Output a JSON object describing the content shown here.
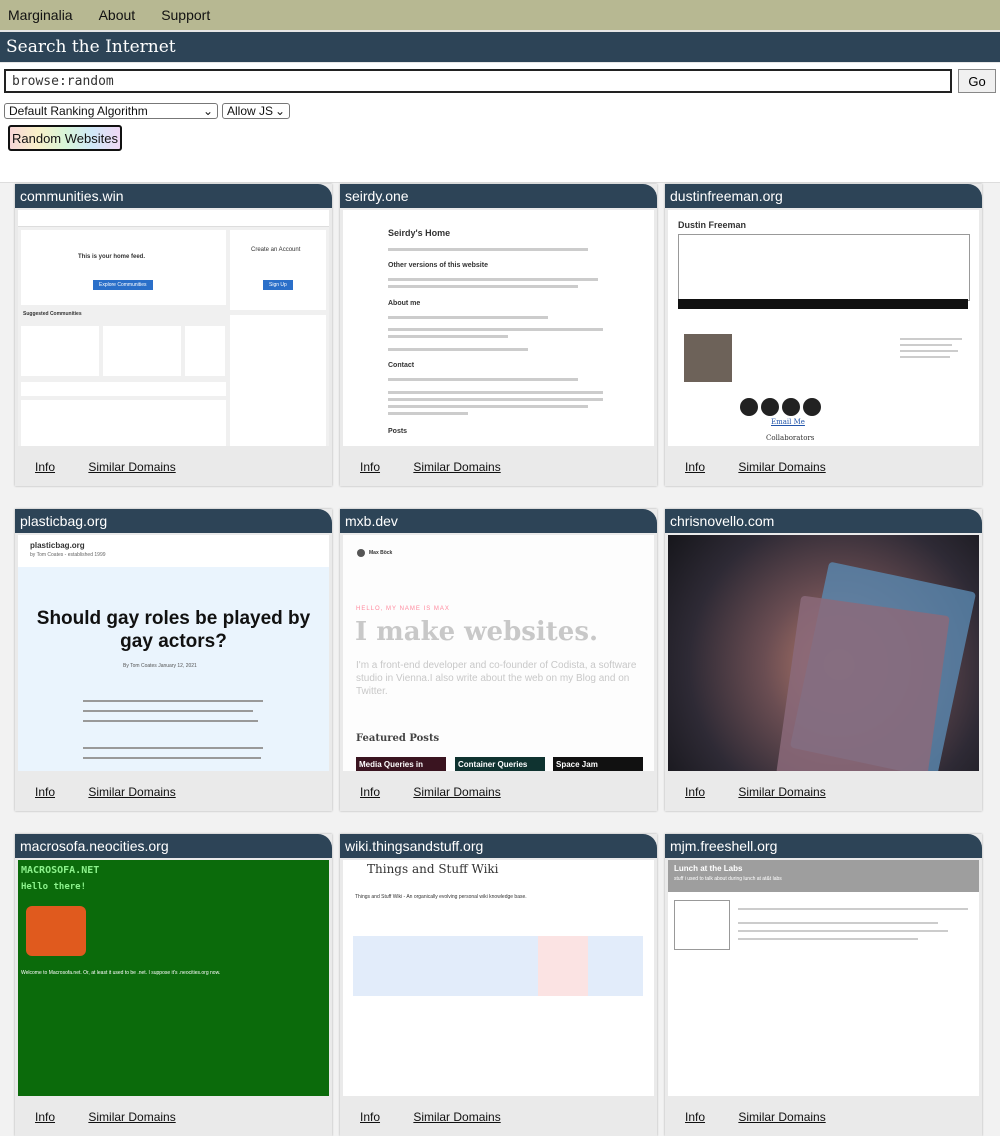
{
  "nav": {
    "items": [
      "Marginalia",
      "About",
      "Support"
    ]
  },
  "search": {
    "title": "Search the Internet",
    "query": "browse:random",
    "go_label": "Go",
    "algorithm": "Default Ranking Algorithm",
    "js": "Allow JS",
    "random_label": "Random Websites"
  },
  "cards": [
    {
      "domain": "communities.win",
      "info": "Info",
      "similar": "Similar Domains",
      "thumb": {
        "title": "This is your home feed.",
        "b1": "Explore Communities",
        "b2": "Create an Account",
        "b3": "Sign Up",
        "sec": "Suggested Communities"
      }
    },
    {
      "domain": "seirdy.one",
      "info": "Info",
      "similar": "Similar Domains",
      "thumb": {
        "h1": "Seirdy's Home",
        "h2a": "Other versions of this website",
        "h2b": "About me",
        "h2c": "Contact",
        "h2d": "Posts"
      }
    },
    {
      "domain": "dustinfreeman.org",
      "info": "Info",
      "similar": "Similar Domains",
      "thumb": {
        "h1": "Dustin Freeman",
        "email": "Email Me",
        "collab": "Collaborators"
      }
    },
    {
      "domain": "plasticbag.org",
      "info": "Info",
      "similar": "Similar Domains",
      "thumb": {
        "site": "plasticbag.org",
        "by": "by Tom Coates - established 1999",
        "h1": "Should gay roles be played by gay actors?",
        "meta": "By Tom Coates    January 12, 2021"
      }
    },
    {
      "domain": "mxb.dev",
      "info": "Info",
      "similar": "Similar Domains",
      "thumb": {
        "name": "Max Böck",
        "hello": "HELLO, MY NAME IS MAX",
        "h1": "I make websites.",
        "p": "I'm a front-end developer and co-founder of Codista, a software studio in Vienna.I also write about the web on my Blog and on Twitter.",
        "featured": "Featured Posts",
        "post1": "Media Queries in",
        "post2": "Container Queries",
        "post3": "Space Jam"
      }
    },
    {
      "domain": "chrisnovello.com",
      "info": "Info",
      "similar": "Similar Domains",
      "thumb": {}
    },
    {
      "domain": "macrosofa.neocities.org",
      "info": "Info",
      "similar": "Similar Domains",
      "thumb": {
        "h1": "MACROSOFA.NET",
        "hello": "Hello there!",
        "p": "Welcome to Macrosofa.net. Or, at least it used to be .net. I suppose it's .neocities.org now."
      }
    },
    {
      "domain": "wiki.thingsandstuff.org",
      "info": "Info",
      "similar": "Similar Domains",
      "thumb": {
        "h1": "Things and Stuff Wiki",
        "p": "Things and Stuff Wiki - An organically evolving personal wiki knowledge base."
      }
    },
    {
      "domain": "mjm.freeshell.org",
      "info": "Info",
      "similar": "Similar Domains",
      "thumb": {
        "h1": "Lunch at the Labs",
        "sub": "stuff i used to talk about during lunch at at&t labs"
      }
    }
  ],
  "colors": {
    "nav_bg": "#b7b892",
    "header_bg": "#2d4457",
    "card_bg": "#eaeaea"
  }
}
